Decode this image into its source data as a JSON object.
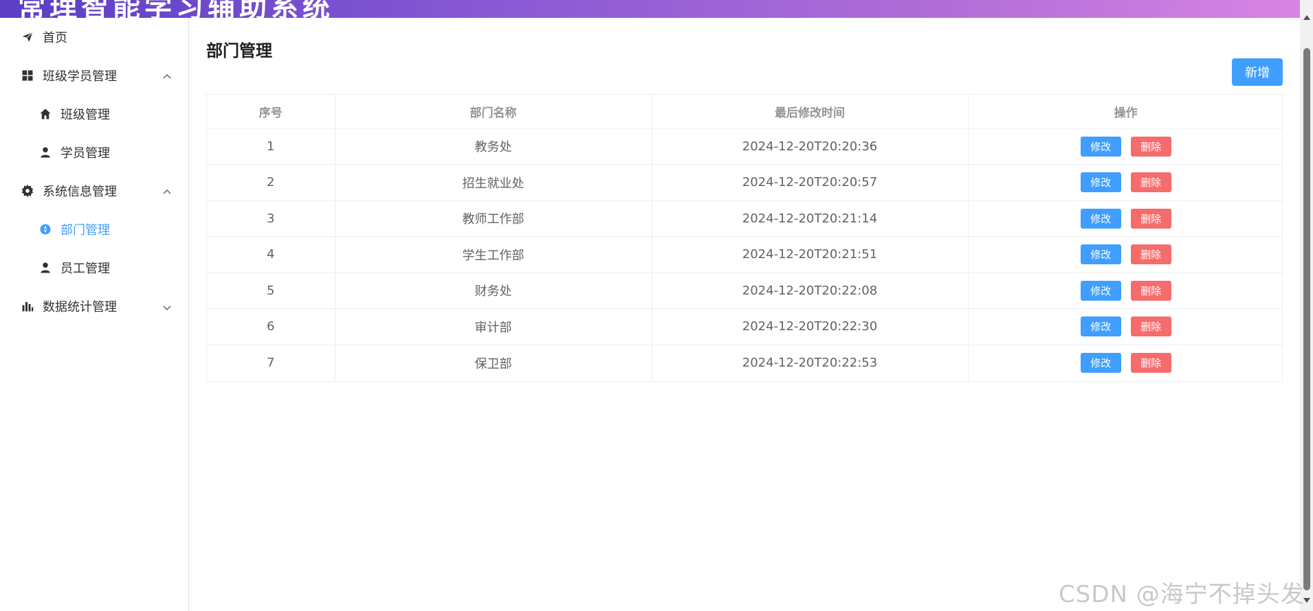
{
  "header": {
    "app_title": "常理智能学习辅助系统"
  },
  "sidebar": {
    "items": [
      {
        "label": "首页",
        "icon": "send-icon",
        "level": 1
      },
      {
        "label": "班级学员管理",
        "icon": "grid-icon",
        "level": 1,
        "expanded": true
      },
      {
        "label": "班级管理",
        "icon": "home-icon",
        "level": 2
      },
      {
        "label": "学员管理",
        "icon": "user-icon",
        "level": 2
      },
      {
        "label": "系统信息管理",
        "icon": "gear-icon",
        "level": 1,
        "expanded": true
      },
      {
        "label": "部门管理",
        "icon": "compass-icon",
        "level": 2,
        "active": true
      },
      {
        "label": "员工管理",
        "icon": "user-icon",
        "level": 2
      },
      {
        "label": "数据统计管理",
        "icon": "bar-chart-icon",
        "level": 1,
        "expanded": false
      }
    ]
  },
  "main": {
    "title": "部门管理",
    "add_label": "新增",
    "table": {
      "columns": [
        "序号",
        "部门名称",
        "最后修改时间",
        "操作"
      ],
      "edit_label": "修改",
      "delete_label": "删除",
      "rows": [
        {
          "index": "1",
          "name": "教务处",
          "updated": "2024-12-20T20:20:36"
        },
        {
          "index": "2",
          "name": "招生就业处",
          "updated": "2024-12-20T20:20:57"
        },
        {
          "index": "3",
          "name": "教师工作部",
          "updated": "2024-12-20T20:21:14"
        },
        {
          "index": "4",
          "name": "学生工作部",
          "updated": "2024-12-20T20:21:51"
        },
        {
          "index": "5",
          "name": "财务处",
          "updated": "2024-12-20T20:22:08"
        },
        {
          "index": "6",
          "name": "审计部",
          "updated": "2024-12-20T20:22:30"
        },
        {
          "index": "7",
          "name": "保卫部",
          "updated": "2024-12-20T20:22:53"
        }
      ]
    }
  },
  "watermark": "CSDN @海宁不掉头发",
  "colors": {
    "primary": "#409eff",
    "danger": "#f56c6c",
    "header_gradient_start": "#5a3fc6",
    "header_gradient_end": "#d884e4"
  }
}
